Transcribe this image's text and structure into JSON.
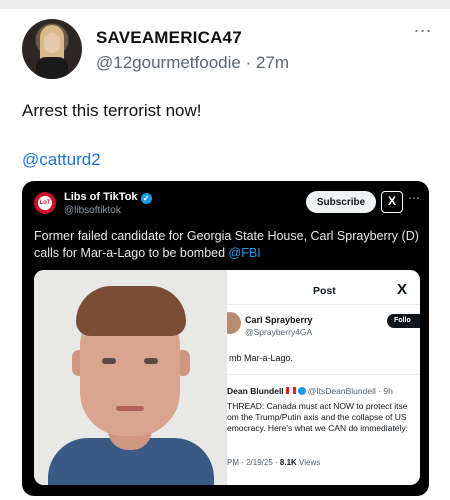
{
  "post": {
    "display_name": "SAVEAMERICA47",
    "handle": "@12gourmetfoodie",
    "time_separator": " · ",
    "time": "27m",
    "more_icon": "more-horizontal-icon",
    "text": "Arrest this terrorist now!",
    "mention": "@catturd2"
  },
  "quote": {
    "author_name": "Libs of TikTok",
    "author_handle": "@libsoftiktok",
    "subscribe_label": "Subscribe",
    "text": "Former failed candidate for Georgia State House, Carl Sprayberry (D) calls for Mar-a-Lago to be bombed ",
    "text_link": "@FBI",
    "media_screenshot": {
      "title": "Post",
      "name": "Carl Sprayberry",
      "handle": "@Sprayberry4GA",
      "follow_label": "Follo",
      "body": "mb Mar-a-Lago.",
      "quoted_name": "Dean Blundell",
      "quoted_handle": "@ItsDeanBlundell · 9h",
      "quoted_text": "THREAD: Canada must act NOW to protect itse\nom the Trump/Putin axis and the collapse of US\nemocracy. Here's what we CAN do immediately:",
      "meta_prefix": "PM · 2/19/25 · ",
      "views_count": "8.1K",
      "views_label": " Views"
    }
  },
  "colors": {
    "link": "#1d73d6",
    "quote_background": "#000000",
    "verified": "#1d9bf0"
  }
}
